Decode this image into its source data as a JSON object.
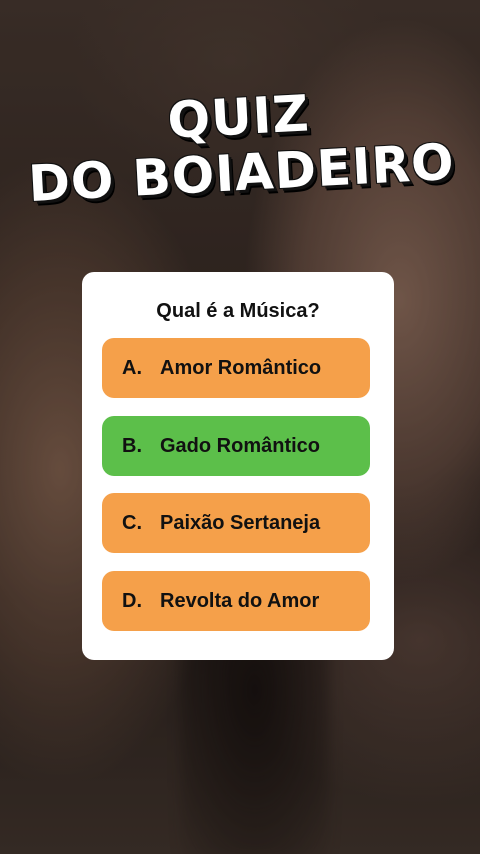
{
  "title": {
    "line1": "QUIZ",
    "line2": "DO BOIADEIRO"
  },
  "question": "Qual é a Música?",
  "options": [
    {
      "letter": "A.",
      "label": "Amor Romântico",
      "color": "#f5a04a"
    },
    {
      "letter": "B.",
      "label": "Gado Romântico",
      "color": "#5cbf4a"
    },
    {
      "letter": "C.",
      "label": "Paixão Sertaneja",
      "color": "#f5a04a"
    },
    {
      "letter": "D.",
      "label": "Revolta do Amor",
      "color": "#f5a04a"
    }
  ],
  "colors": {
    "orange": "#f5a04a",
    "green": "#5cbf4a",
    "card": "#ffffff"
  }
}
